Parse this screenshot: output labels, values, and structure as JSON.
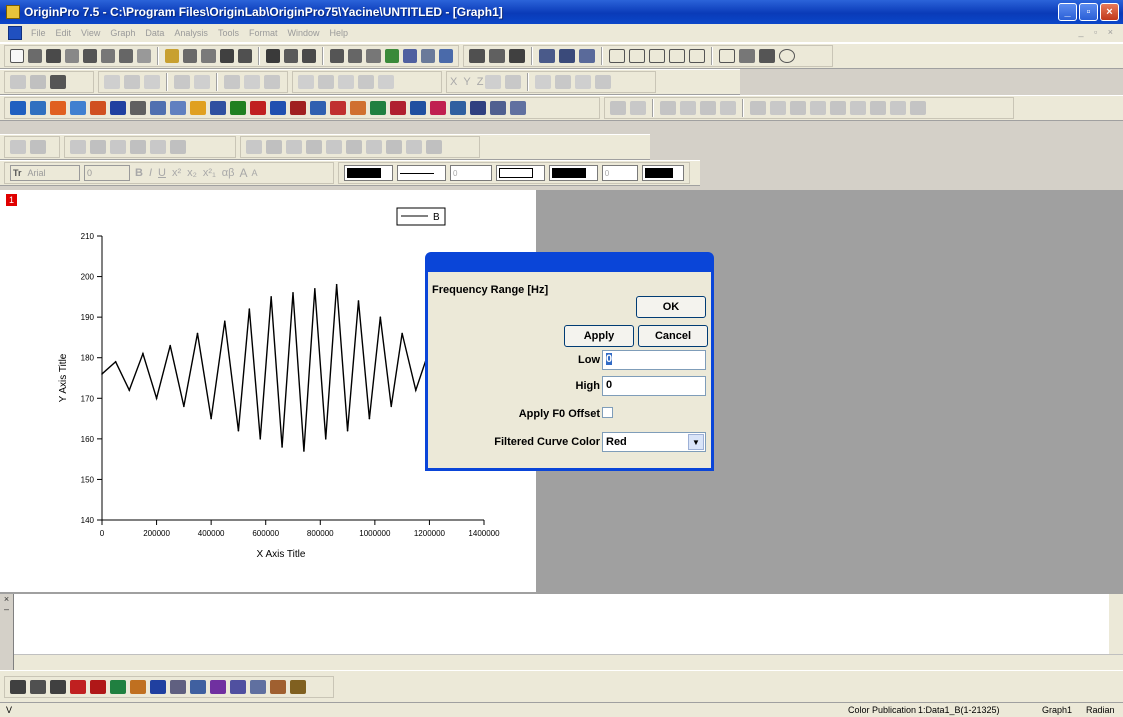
{
  "window": {
    "title": "OriginPro 7.5 - C:\\Program Files\\OriginLab\\OriginPro75\\Yacine\\UNTITLED - [Graph1]"
  },
  "menubar": {
    "items": [
      "File",
      "Edit",
      "View",
      "Graph",
      "Data",
      "Analysis",
      "Tools",
      "Format",
      "Window",
      "Help"
    ]
  },
  "format_toolbar": {
    "font_button": "Tr",
    "font_name": "Arial",
    "font_size": "0",
    "bold": "B",
    "italic": "I",
    "underline": "U",
    "greek": "αβ",
    "larger": "A",
    "smaller": "A"
  },
  "graph": {
    "layer_number": "1",
    "legend_label": "B"
  },
  "chart_data": {
    "type": "line",
    "title": "",
    "xlabel": "X Axis Title",
    "ylabel": "Y Axis Title",
    "xlim": [
      0,
      1400000
    ],
    "ylim": [
      140,
      210
    ],
    "x_ticks": [
      "0",
      "200000",
      "400000",
      "600000",
      "800000",
      "1000000",
      "1200000",
      "1400000"
    ],
    "y_ticks": [
      "140",
      "150",
      "160",
      "170",
      "180",
      "190",
      "200",
      "210"
    ],
    "series": [
      {
        "name": "B",
        "color": "#000000",
        "x": [
          0,
          50000,
          100000,
          150000,
          200000,
          250000,
          300000,
          350000,
          400000,
          450000,
          500000,
          540000,
          580000,
          620000,
          660000,
          700000,
          740000,
          780000,
          820000,
          860000,
          900000,
          940000,
          980000,
          1020000,
          1060000,
          1100000,
          1150000,
          1200000,
          1250000,
          1300000
        ],
        "y": [
          176,
          179,
          172,
          181,
          170,
          183,
          168,
          186,
          165,
          189,
          162,
          192,
          160,
          195,
          158,
          196,
          157,
          197,
          160,
          198,
          162,
          194,
          165,
          190,
          168,
          186,
          172,
          182,
          175,
          179
        ]
      }
    ],
    "grid": false,
    "legend_position": "top-right"
  },
  "dialog": {
    "title": "Frequency Range [Hz]",
    "ok": "OK",
    "apply": "Apply",
    "cancel": "Cancel",
    "low_label": "Low",
    "low_value": "0",
    "high_label": "High",
    "high_value": "0",
    "offset_label": "Apply F0 Offset",
    "color_label": "Filtered Curve Color",
    "color_value": "Red"
  },
  "statusbar": {
    "left": "V",
    "mode": "Color Publication",
    "dataset": "1:Data1_B(1-21325)",
    "window": "Graph1",
    "angle": "Radian"
  }
}
